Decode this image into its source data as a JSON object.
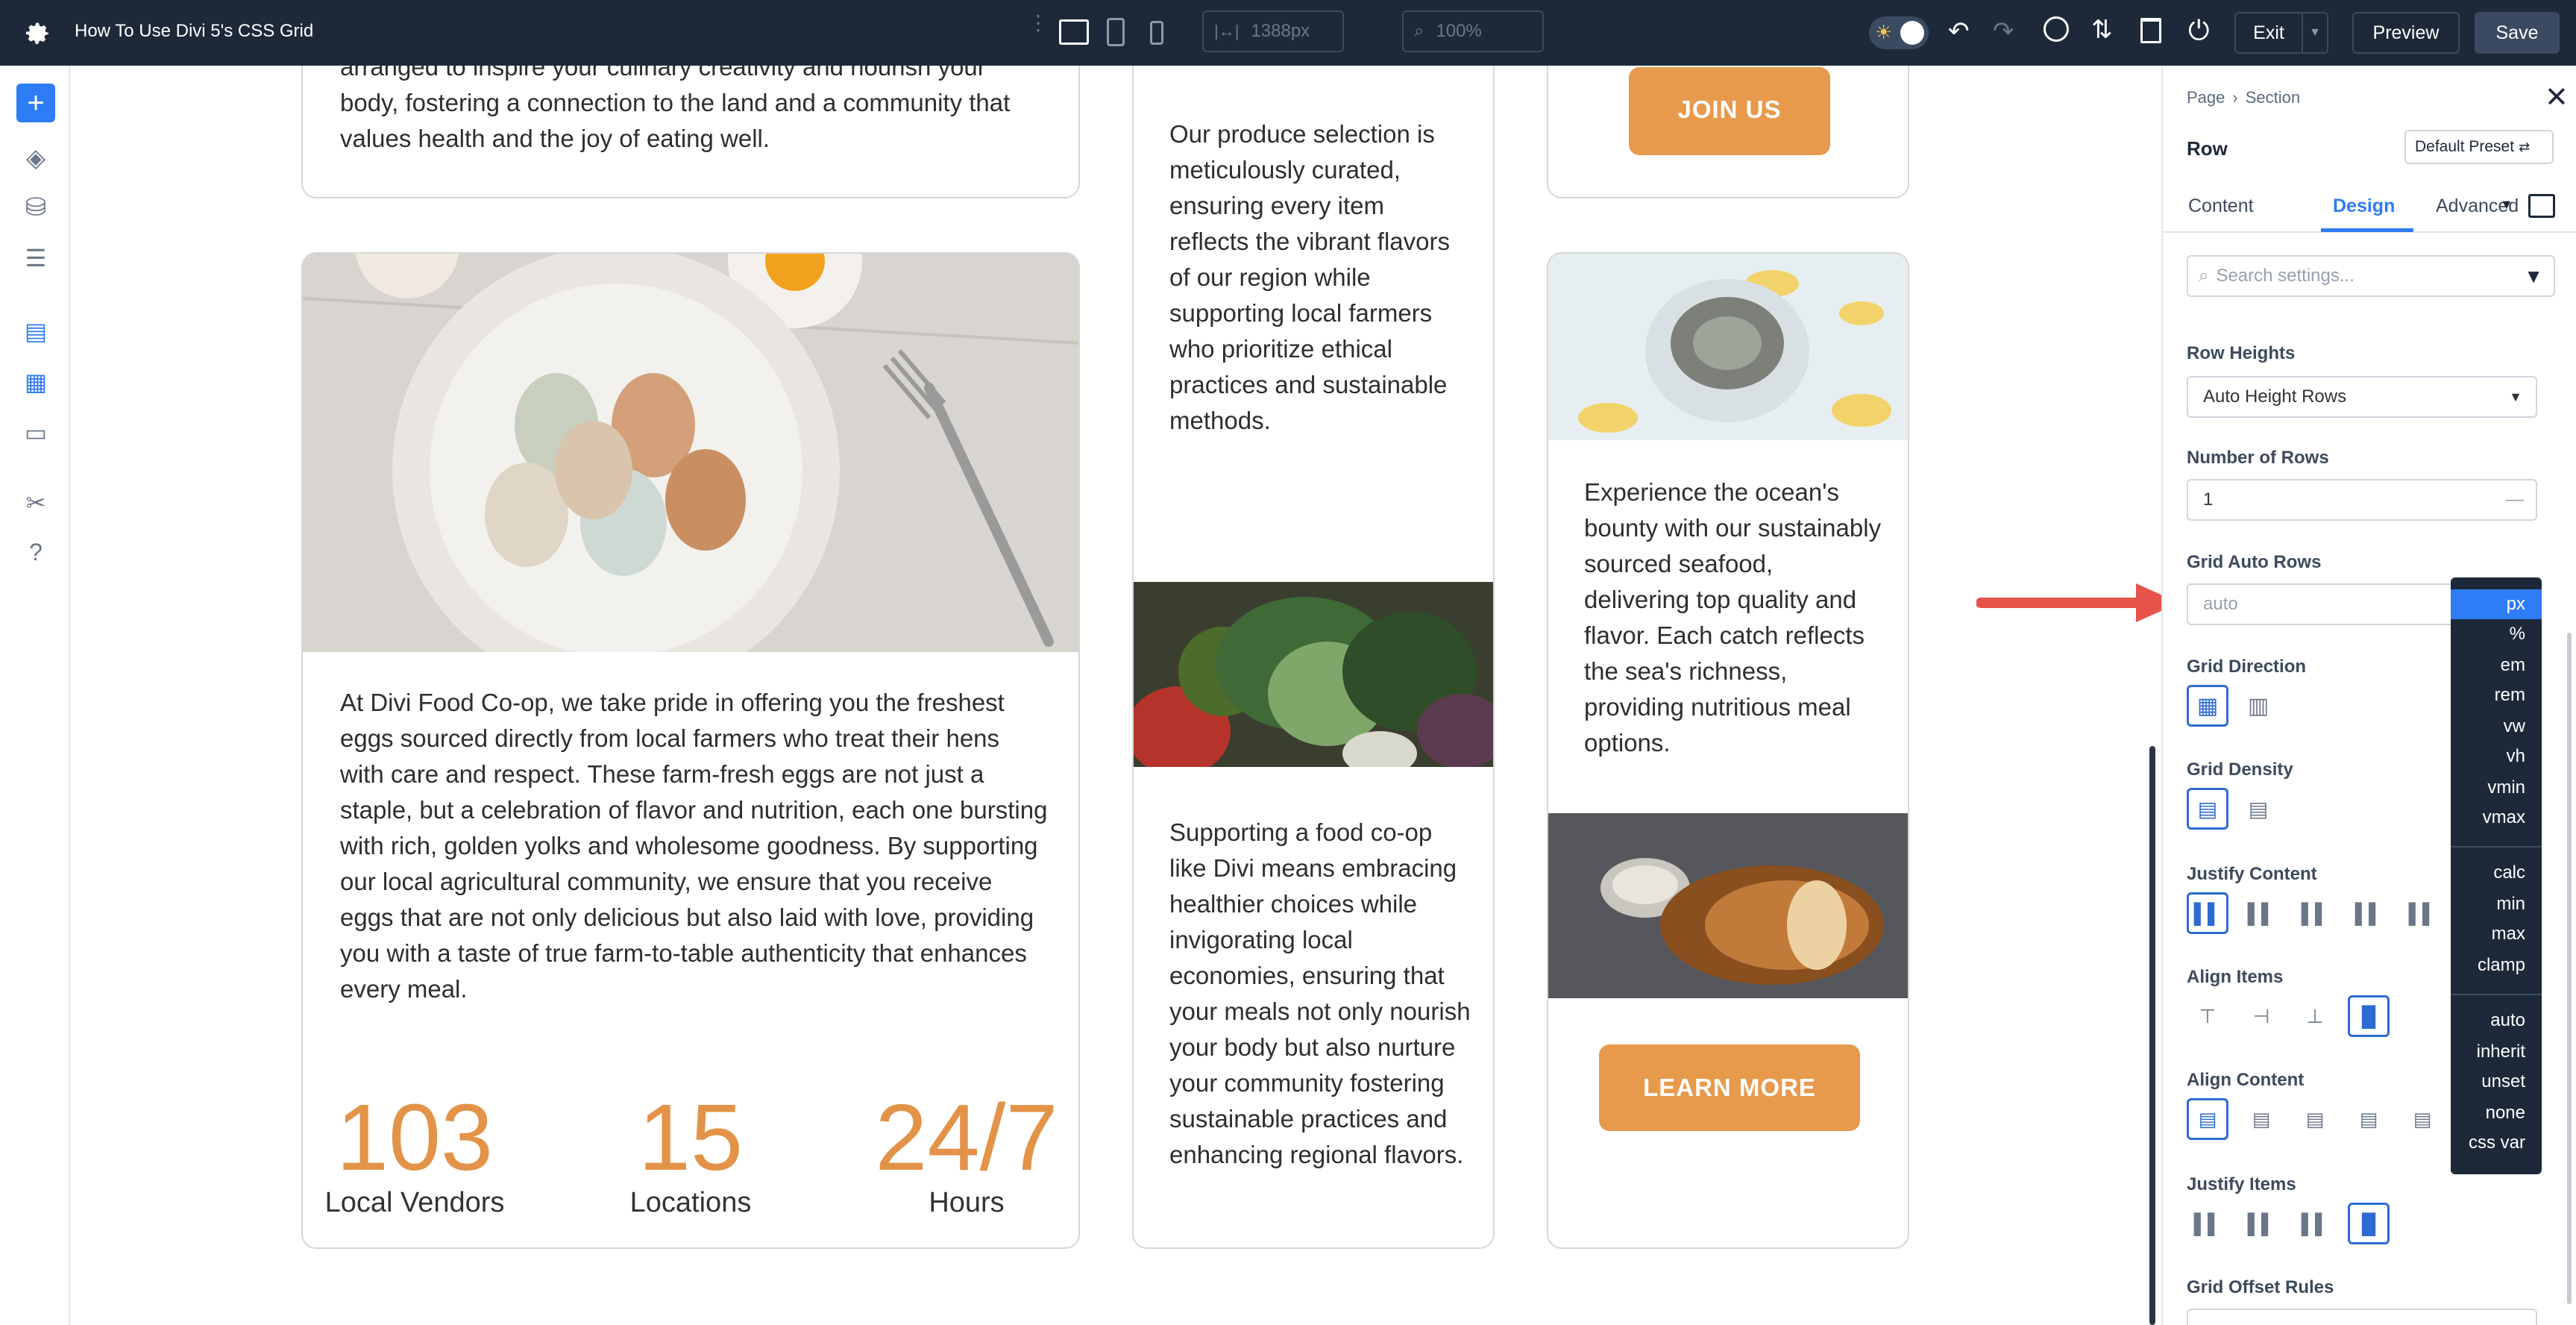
{
  "app": {
    "title": "How To Use Divi 5's CSS Grid"
  },
  "toolbar": {
    "width_value": "1388px",
    "zoom_value": "100%",
    "exit_label": "Exit",
    "preview_label": "Preview",
    "save_label": "Save"
  },
  "canvas": {
    "card1_text": "arranged to inspire your culinary creativity and nourish your body, fostering a connection to the land and a community that values health and the joy of eating well.",
    "eggs_text": "At Divi Food Co-op, we take pride in offering you the freshest eggs sourced directly from local farmers who treat their hens with care and respect. These farm-fresh eggs are not just a staple, but a celebration of flavor and nutrition, each one bursting with rich, golden yolks and wholesome goodness. By supporting our local agricultural community, we ensure that you receive eggs that are not only delicious but also laid with love, providing you with a taste of true farm-to-table authenticity that enhances every meal.",
    "stats": [
      {
        "number": "103",
        "label": "Local Vendors"
      },
      {
        "number": "15",
        "label": "Locations"
      },
      {
        "number": "24/7",
        "label": "Hours"
      }
    ],
    "produce_text": "Our produce selection is meticulously curated, ensuring every item reflects the vibrant flavors of our region while supporting local farmers who prioritize ethical practices and sustainable methods.",
    "coop_text": "Supporting a food co-op like Divi means embracing healthier choices while invigorating local economies, ensuring that your meals not only nourish your body but also nurture your community fostering sustainable practices and enhancing regional flavors.",
    "join_label": "JOIN US",
    "seafood_text": "Experience the ocean's bounty with our sustainably sourced seafood, delivering top quality and flavor. Each catch reflects the sea's richness, providing nutritious meal options.",
    "learn_label": "LEARN MORE"
  },
  "panel": {
    "breadcrumb": [
      "Page",
      "Section"
    ],
    "element_title": "Row",
    "preset_label": "Default Preset",
    "tabs": [
      "Content",
      "Design",
      "Advanced"
    ],
    "active_tab": "Design",
    "search_placeholder": "Search settings...",
    "row_heights_label": "Row Heights",
    "row_heights_value": "Auto Height Rows",
    "number_rows_label": "Number of Rows",
    "number_rows_value": "1",
    "grid_auto_rows_label": "Grid Auto Rows",
    "grid_auto_rows_placeholder": "auto",
    "grid_direction_label": "Grid Direction",
    "grid_density_label": "Grid Density",
    "justify_content_label": "Justify Content",
    "align_items_label": "Align Items",
    "align_content_label": "Align Content",
    "justify_items_label": "Justify Items",
    "grid_offset_label": "Grid Offset Rules"
  },
  "unit_menu": {
    "options": [
      "px",
      "%",
      "em",
      "rem",
      "vw",
      "vh",
      "vmin",
      "vmax",
      "calc",
      "min",
      "max",
      "clamp",
      "auto",
      "inherit",
      "unset",
      "none",
      "css var"
    ],
    "selected": "px"
  },
  "colors": {
    "accent": "#2e7cf6",
    "topbar": "#1d2939",
    "orange": "#e79a4c",
    "arrow": "#e5534b"
  }
}
